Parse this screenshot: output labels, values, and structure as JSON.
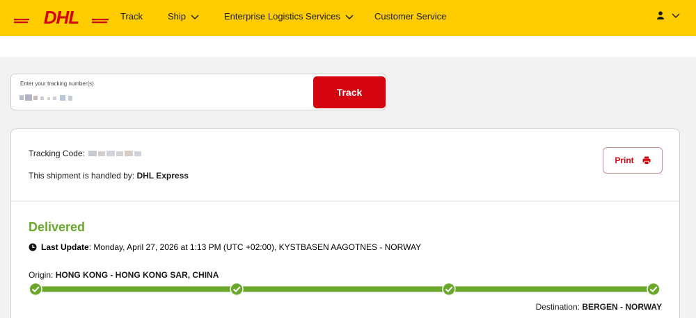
{
  "nav": {
    "brand": "DHL",
    "items": [
      "Track",
      "Ship",
      "Enterprise Logistics Services",
      "Customer Service"
    ]
  },
  "tracking_form": {
    "label": "Enter your tracking number(s)",
    "button": "Track"
  },
  "shipment": {
    "tracking_code_label": "Tracking Code:",
    "handled_by_label": "This shipment is handled by:",
    "handler": "DHL Express",
    "print_label": "Print",
    "status": "Delivered",
    "last_update_label": "Last Update",
    "last_update_value": ": Monday, April 27, 2026 at 1:13 PM (UTC +02:00), KYSTBASEN AAGOTNES - NORWAY",
    "origin_label": "Origin:",
    "origin": "HONG KONG - HONG KONG SAR, CHINA",
    "destination_label": "Destination:",
    "destination": "BERGEN - NORWAY",
    "progress_steps_completed": 4,
    "progress_steps_total": 4
  },
  "colors": {
    "brand_yellow": "#ffcc00",
    "brand_red": "#d40511",
    "delivered_green": "#6aa82c"
  }
}
